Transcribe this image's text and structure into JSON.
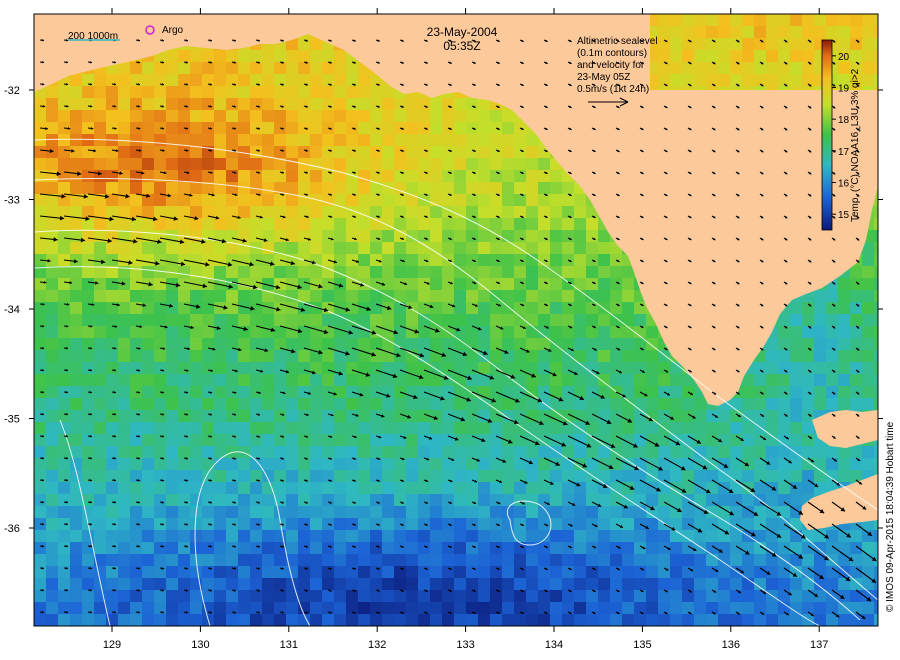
{
  "map": {
    "date": "23-May-2004",
    "time": "05:35Z",
    "bathymetry_legend": "200  1000m",
    "argo_label": "Argo",
    "velocity_note": [
      "Altimetric sealevel",
      "(0.1m contours)",
      "and velocity for",
      "23-May 05Z",
      "0.5m/s (1kt 24h)"
    ],
    "colorbar": {
      "label": "Temp. (°C) NOAA16_L3U 3% qi>2",
      "ticks": [
        "15",
        "16",
        "17",
        "18",
        "19",
        "20"
      ],
      "range": [
        14.5,
        20.5
      ]
    },
    "credit": "© IMOS 09-Apr-2015 18:04:39 Hobart time",
    "lon_ticks": [
      "129",
      "130",
      "131",
      "132",
      "133",
      "134",
      "135",
      "136",
      "137"
    ],
    "lat_ticks": [
      "-32",
      "-33",
      "-34",
      "-35",
      "-36"
    ],
    "colors": {
      "land": "#fcc99b",
      "frame": "#000000",
      "contour": "#ffffff"
    }
  }
}
